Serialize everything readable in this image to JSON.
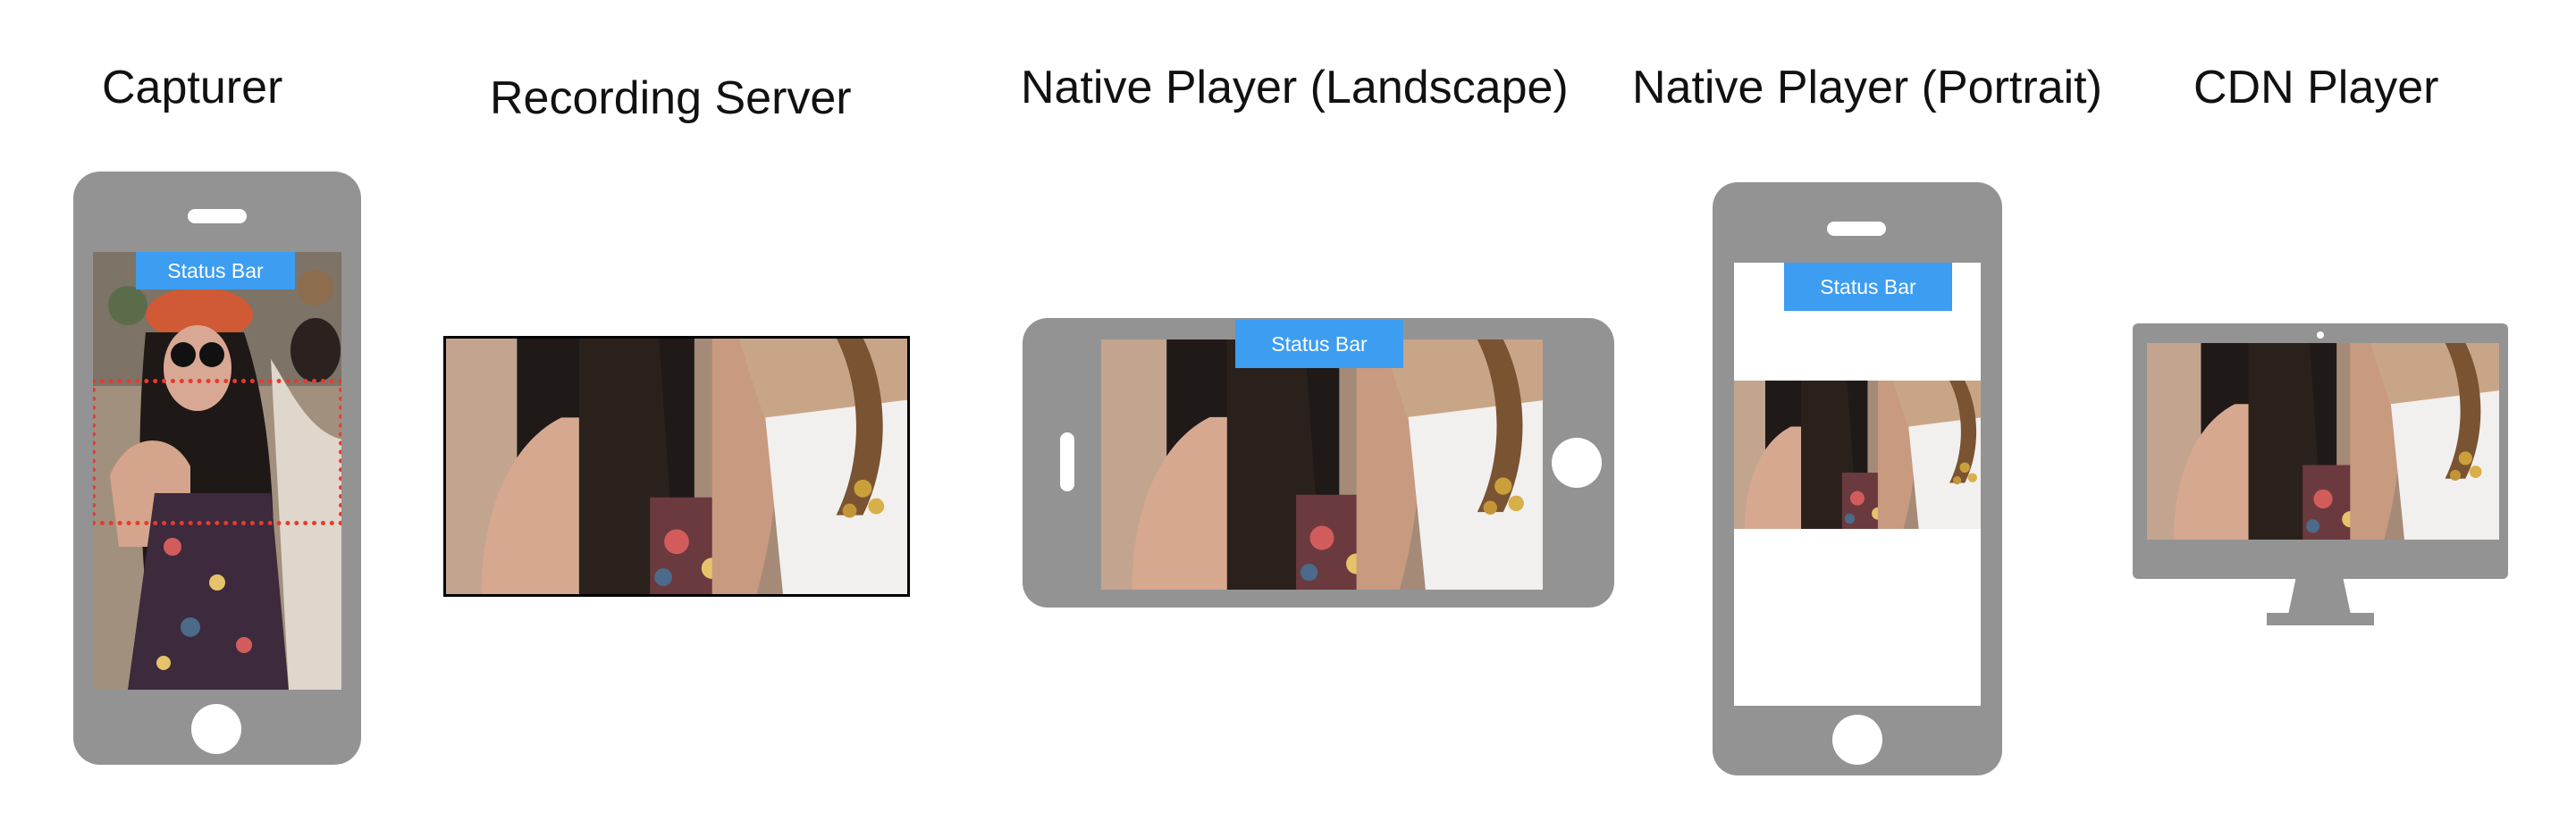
{
  "titles": {
    "capturer": "Capturer",
    "recording_server": "Recording Server",
    "native_landscape": "Native Player (Landscape)",
    "native_portrait": "Native Player (Portrait)",
    "cdn_player": "CDN Player"
  },
  "status_bar_label": "Status Bar",
  "colors": {
    "device_gray": "#939393",
    "status_bar_blue": "#3d9df1",
    "crop_outline_red": "#e83a2f"
  },
  "icons": {
    "home_button": "home-button-icon",
    "speaker_slot": "speaker-slot-icon",
    "webcam_dot": "webcam-icon"
  }
}
